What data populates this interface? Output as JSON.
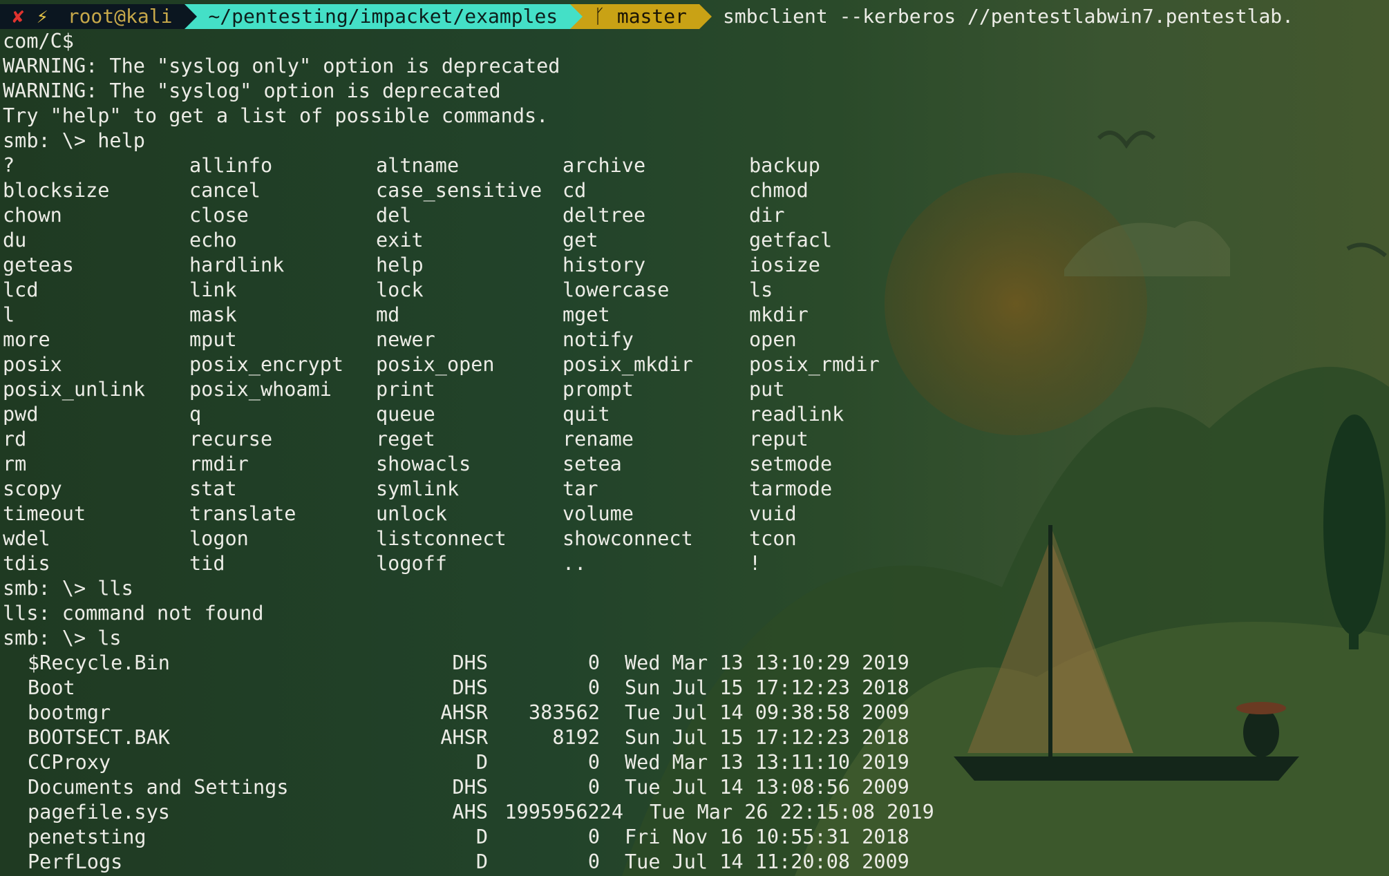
{
  "prompt": {
    "status_icon": "x-icon",
    "bolt_icon": "bolt-icon",
    "user_host": "root@kali",
    "path": "~/pentesting/impacket/examples",
    "git_icon": "git-branch-icon",
    "git_branch": "master",
    "command": "smbclient --kerberos //pentestlabwin7.pentestlab.",
    "command_wrap": "com/C$"
  },
  "output_lines": [
    "WARNING: The \"syslog only\" option is deprecated",
    "WARNING: The \"syslog\" option is deprecated",
    "Try \"help\" to get a list of possible commands.",
    "smb: \\> help"
  ],
  "help_grid": [
    [
      "?",
      "allinfo",
      "altname",
      "archive",
      "backup"
    ],
    [
      "blocksize",
      "cancel",
      "case_sensitive",
      "cd",
      "chmod"
    ],
    [
      "chown",
      "close",
      "del",
      "deltree",
      "dir"
    ],
    [
      "du",
      "echo",
      "exit",
      "get",
      "getfacl"
    ],
    [
      "geteas",
      "hardlink",
      "help",
      "history",
      "iosize"
    ],
    [
      "lcd",
      "link",
      "lock",
      "lowercase",
      "ls"
    ],
    [
      "l",
      "mask",
      "md",
      "mget",
      "mkdir"
    ],
    [
      "more",
      "mput",
      "newer",
      "notify",
      "open"
    ],
    [
      "posix",
      "posix_encrypt",
      "posix_open",
      "posix_mkdir",
      "posix_rmdir"
    ],
    [
      "posix_unlink",
      "posix_whoami",
      "print",
      "prompt",
      "put"
    ],
    [
      "pwd",
      "q",
      "queue",
      "quit",
      "readlink"
    ],
    [
      "rd",
      "recurse",
      "reget",
      "rename",
      "reput"
    ],
    [
      "rm",
      "rmdir",
      "showacls",
      "setea",
      "setmode"
    ],
    [
      "scopy",
      "stat",
      "symlink",
      "tar",
      "tarmode"
    ],
    [
      "timeout",
      "translate",
      "unlock",
      "volume",
      "vuid"
    ],
    [
      "wdel",
      "logon",
      "listconnect",
      "showconnect",
      "tcon"
    ],
    [
      "tdis",
      "tid",
      "logoff",
      "..",
      "!"
    ]
  ],
  "after_help_lines": [
    "smb: \\> lls",
    "lls: command not found",
    "smb: \\> ls"
  ],
  "ls_entries": [
    {
      "name": "$Recycle.Bin",
      "attr": "DHS",
      "size": "0",
      "date": "Wed Mar 13 13:10:29 2019"
    },
    {
      "name": "Boot",
      "attr": "DHS",
      "size": "0",
      "date": "Sun Jul 15 17:12:23 2018"
    },
    {
      "name": "bootmgr",
      "attr": "AHSR",
      "size": "383562",
      "date": "Tue Jul 14 09:38:58 2009"
    },
    {
      "name": "BOOTSECT.BAK",
      "attr": "AHSR",
      "size": "8192",
      "date": "Sun Jul 15 17:12:23 2018"
    },
    {
      "name": "CCProxy",
      "attr": "D",
      "size": "0",
      "date": "Wed Mar 13 13:11:10 2019"
    },
    {
      "name": "Documents and Settings",
      "attr": "DHS",
      "size": "0",
      "date": "Tue Jul 14 13:08:56 2009"
    },
    {
      "name": "pagefile.sys",
      "attr": "AHS",
      "size": "1995956224",
      "date": "Tue Mar 26 22:15:08 2019"
    },
    {
      "name": "penetsting",
      "attr": "D",
      "size": "0",
      "date": "Fri Nov 16 10:55:31 2018"
    },
    {
      "name": "PerfLogs",
      "attr": "D",
      "size": "0",
      "date": "Tue Jul 14 11:20:08 2009"
    }
  ],
  "colors": {
    "prompt_bg": "#0b1620",
    "path_bg": "#44e0c7",
    "git_bg": "#c9a215",
    "text": "#ecece6",
    "error_x": "#e0332f"
  }
}
